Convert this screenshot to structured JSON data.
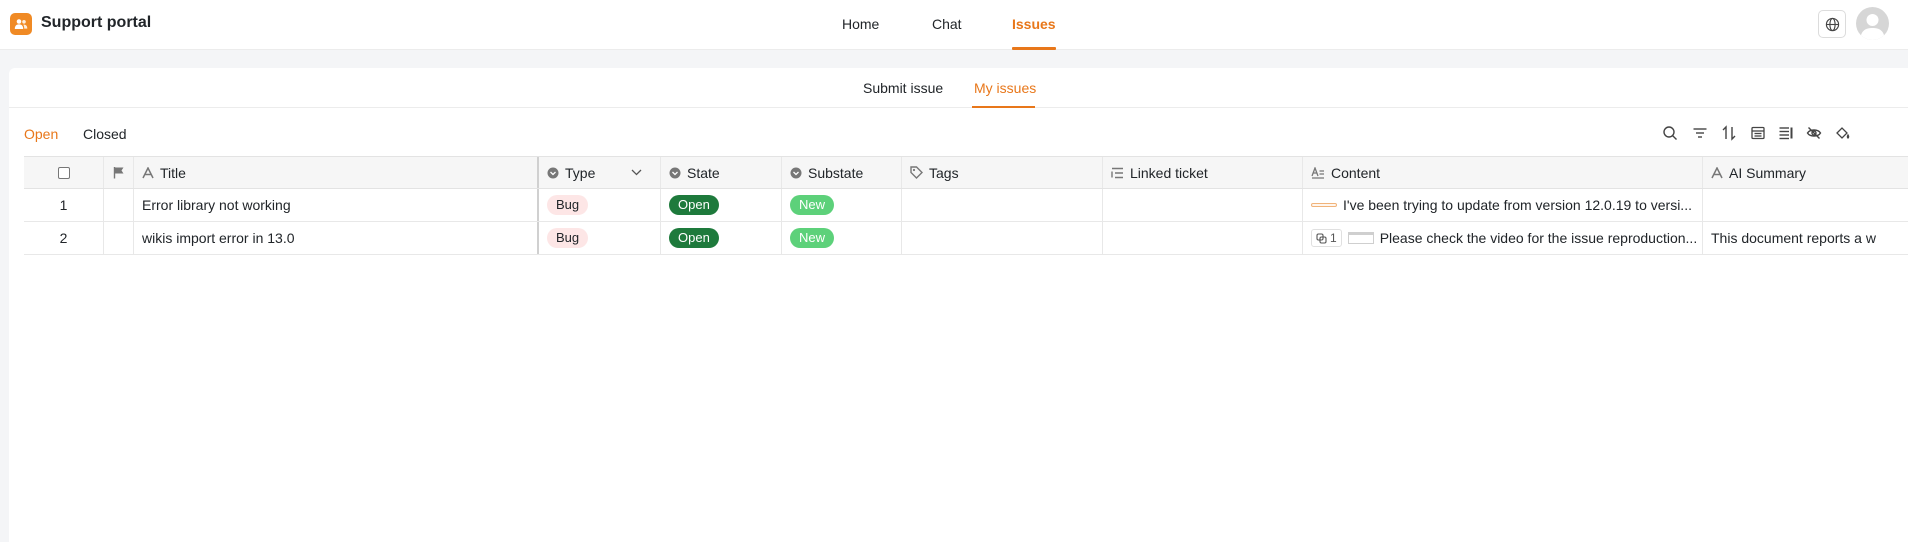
{
  "header": {
    "app_title": "Support portal",
    "nav": [
      "Home",
      "Chat",
      "Issues"
    ],
    "active_nav": "Issues",
    "logo_icon": "users-icon",
    "accent_color": "#e8771a"
  },
  "subtabs": {
    "submit": "Submit issue",
    "mine": "My issues",
    "active": "My issues"
  },
  "filters": {
    "open": "Open",
    "closed": "Closed",
    "active": "Open"
  },
  "toolbar": [
    "search-icon",
    "filter-icon",
    "sort-icon",
    "group-icon",
    "row-height-icon",
    "hide-fields-icon",
    "color-icon"
  ],
  "columns": {
    "title": "Title",
    "type": "Type",
    "state": "State",
    "substate": "Substate",
    "tags": "Tags",
    "linked": "Linked ticket",
    "content": "Content",
    "ai_summary": "AI Summary"
  },
  "rows": [
    {
      "num": "1",
      "title": "Error library not working",
      "type": "Bug",
      "state": "Open",
      "substate": "New",
      "content": "I've been trying to update from version 12.0.19 to versi...",
      "ai_summary": ""
    },
    {
      "num": "2",
      "title": "wikis import error in 13.0",
      "type": "Bug",
      "state": "Open",
      "substate": "New",
      "attachment_count": "1",
      "content": "Please check the video for the issue reproduction...",
      "ai_summary": "This document reports a w"
    }
  ],
  "colors": {
    "state_open": "#1e7a3c",
    "substate_new": "#5dd17a",
    "type_bug_bg": "#fde6e6"
  }
}
